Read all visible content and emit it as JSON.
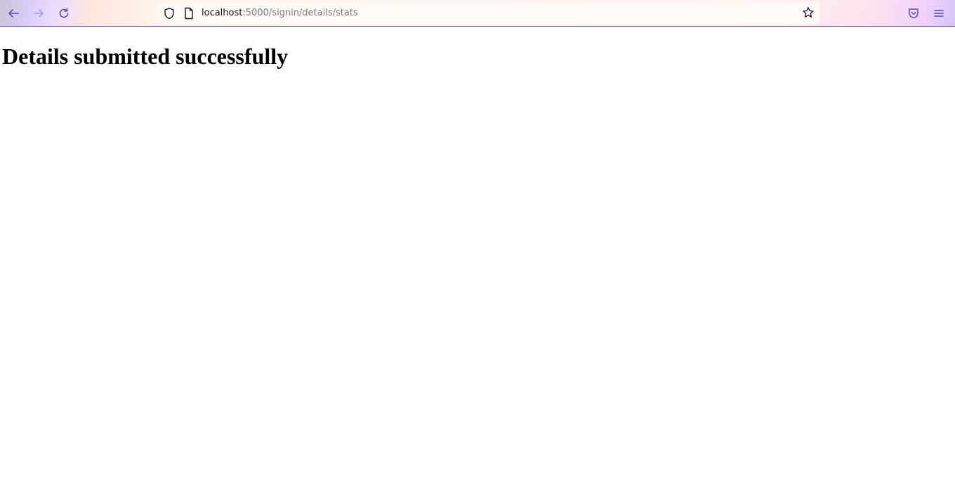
{
  "browser": {
    "url_host": "localhost",
    "url_path": ":5000/signin/details/stats",
    "icons": {
      "back": "back-arrow-icon",
      "forward": "forward-arrow-icon",
      "reload": "reload-icon",
      "tracking_protection": "shield-icon",
      "page_info": "page-icon",
      "bookmark": "star-icon",
      "pocket": "pocket-icon",
      "menu": "hamburger-menu-icon"
    },
    "accent_color": "#6f59c7"
  },
  "page": {
    "heading": "Details submitted successfully"
  }
}
